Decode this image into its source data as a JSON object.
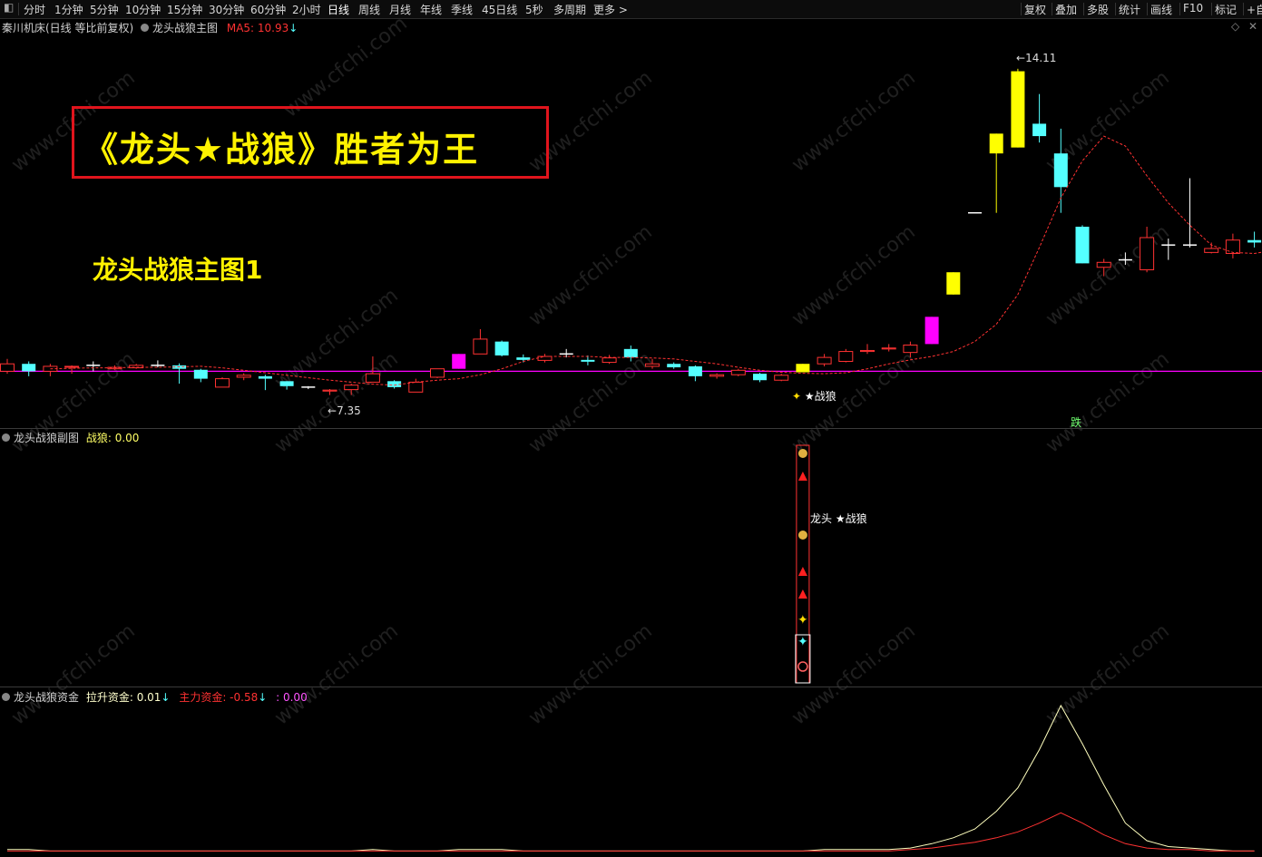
{
  "toolbar": {
    "left_items": [
      "分时",
      "1分钟",
      "5分钟",
      "10分钟",
      "15分钟",
      "30分钟",
      "60分钟",
      "2小时",
      "日线",
      "周线",
      "月线",
      "年线",
      "季线",
      "45日线",
      "5秒",
      "多周期",
      "更多 >"
    ],
    "right_items": [
      "复权",
      "叠加",
      "多股",
      "统计",
      "画线",
      "F10",
      "标记",
      "+自"
    ],
    "active": "日线"
  },
  "main_pane": {
    "stock": "秦川机床(日线 等比前复权)",
    "indicator": "龙头战狼主图",
    "ma_label": "MA5: 10.93",
    "ma_arrow": "↓",
    "high_label": "14.11",
    "low_label": "7.35",
    "signal_label": "★战狼",
    "die_label": "跌",
    "banner": "《龙头★战狼》胜者为王",
    "subtitle": "龙头战狼主图1"
  },
  "sub_pane": {
    "indicator": "龙头战狼副图",
    "value_label": "战狼: 0.00",
    "signal_text": "龙头 ★战狼"
  },
  "fund_pane": {
    "indicator": "龙头战狼资金",
    "lift_label": "拉升资金: 0.01",
    "lift_arrow": "↓",
    "main_label": "主力资金: -0.58",
    "main_arrow": "↓",
    "other_label": ": 0.00"
  },
  "watermark": "www.cfchi.com",
  "colors": {
    "up": "#ff3232",
    "down": "#54ffff",
    "yellow": "#ffff00",
    "magenta": "#ff00ff",
    "ma": "#ff3232",
    "baseline": "#ff00ff",
    "lift_line": "#ffffbe",
    "main_line": "#ff3232"
  },
  "chart_data": {
    "type": "candlestick",
    "price_ylim": [
      7.0,
      14.4
    ],
    "baseline": 8.0,
    "candles": [
      {
        "o": 8.0,
        "h": 8.25,
        "l": 7.95,
        "c": 8.15,
        "k": "up"
      },
      {
        "o": 8.15,
        "h": 8.2,
        "l": 7.9,
        "c": 8.0,
        "k": "down"
      },
      {
        "o": 8.0,
        "h": 8.15,
        "l": 7.9,
        "c": 8.1,
        "k": "up"
      },
      {
        "o": 8.1,
        "h": 8.12,
        "l": 7.95,
        "c": 8.1,
        "k": "up"
      },
      {
        "o": 8.1,
        "h": 8.2,
        "l": 8.0,
        "c": 8.12,
        "k": "flat"
      },
      {
        "o": 8.05,
        "h": 8.12,
        "l": 8.03,
        "c": 8.08,
        "k": "up"
      },
      {
        "o": 8.07,
        "h": 8.15,
        "l": 8.05,
        "c": 8.12,
        "k": "up"
      },
      {
        "o": 8.12,
        "h": 8.22,
        "l": 8.08,
        "c": 8.12,
        "k": "flat"
      },
      {
        "o": 8.12,
        "h": 8.16,
        "l": 7.75,
        "c": 8.05,
        "k": "down"
      },
      {
        "o": 8.03,
        "h": 8.05,
        "l": 7.78,
        "c": 7.85,
        "k": "down"
      },
      {
        "o": 7.68,
        "h": 7.88,
        "l": 7.68,
        "c": 7.85,
        "k": "up"
      },
      {
        "o": 7.88,
        "h": 7.96,
        "l": 7.82,
        "c": 7.92,
        "k": "up"
      },
      {
        "o": 7.9,
        "h": 7.93,
        "l": 7.62,
        "c": 7.85,
        "k": "down"
      },
      {
        "o": 7.8,
        "h": 7.8,
        "l": 7.63,
        "c": 7.7,
        "k": "down"
      },
      {
        "o": 7.68,
        "h": 7.7,
        "l": 7.64,
        "c": 7.68,
        "k": "flat"
      },
      {
        "o": 7.6,
        "h": 7.64,
        "l": 7.52,
        "c": 7.62,
        "k": "up"
      },
      {
        "o": 7.63,
        "h": 7.75,
        "l": 7.52,
        "c": 7.72,
        "k": "up"
      },
      {
        "o": 7.78,
        "h": 8.3,
        "l": 7.78,
        "c": 7.95,
        "k": "up"
      },
      {
        "o": 7.8,
        "h": 7.82,
        "l": 7.65,
        "c": 7.68,
        "k": "down"
      },
      {
        "o": 7.58,
        "h": 7.85,
        "l": 7.58,
        "c": 7.78,
        "k": "up"
      },
      {
        "o": 7.88,
        "h": 8.05,
        "l": 7.86,
        "c": 8.05,
        "k": "up"
      },
      {
        "o": 8.05,
        "h": 8.35,
        "l": 8.05,
        "c": 8.35,
        "k": "magenta"
      },
      {
        "o": 8.35,
        "h": 8.85,
        "l": 8.35,
        "c": 8.65,
        "k": "up"
      },
      {
        "o": 8.6,
        "h": 8.62,
        "l": 8.3,
        "c": 8.32,
        "k": "down"
      },
      {
        "o": 8.28,
        "h": 8.34,
        "l": 8.18,
        "c": 8.23,
        "k": "down"
      },
      {
        "o": 8.22,
        "h": 8.35,
        "l": 8.18,
        "c": 8.3,
        "k": "up"
      },
      {
        "o": 8.33,
        "h": 8.45,
        "l": 8.28,
        "c": 8.35,
        "k": "flat"
      },
      {
        "o": 8.23,
        "h": 8.32,
        "l": 8.12,
        "c": 8.2,
        "k": "down"
      },
      {
        "o": 8.18,
        "h": 8.33,
        "l": 8.15,
        "c": 8.27,
        "k": "up"
      },
      {
        "o": 8.45,
        "h": 8.52,
        "l": 8.2,
        "c": 8.28,
        "k": "down"
      },
      {
        "o": 8.1,
        "h": 8.25,
        "l": 8.05,
        "c": 8.15,
        "k": "up"
      },
      {
        "o": 8.15,
        "h": 8.18,
        "l": 8.05,
        "c": 8.08,
        "k": "down"
      },
      {
        "o": 8.1,
        "h": 8.12,
        "l": 7.8,
        "c": 7.9,
        "k": "down"
      },
      {
        "o": 7.9,
        "h": 7.96,
        "l": 7.85,
        "c": 7.93,
        "k": "up"
      },
      {
        "o": 7.93,
        "h": 8.05,
        "l": 7.9,
        "c": 8.02,
        "k": "up"
      },
      {
        "o": 7.95,
        "h": 7.97,
        "l": 7.78,
        "c": 7.82,
        "k": "down"
      },
      {
        "o": 7.82,
        "h": 7.95,
        "l": 7.8,
        "c": 7.92,
        "k": "up"
      },
      {
        "o": 7.98,
        "h": 8.15,
        "l": 7.98,
        "c": 8.15,
        "k": "yellow"
      },
      {
        "o": 8.15,
        "h": 8.35,
        "l": 8.1,
        "c": 8.28,
        "k": "up"
      },
      {
        "o": 8.2,
        "h": 8.45,
        "l": 8.18,
        "c": 8.4,
        "k": "up"
      },
      {
        "o": 8.4,
        "h": 8.55,
        "l": 8.35,
        "c": 8.42,
        "k": "up"
      },
      {
        "o": 8.45,
        "h": 8.55,
        "l": 8.4,
        "c": 8.47,
        "k": "up"
      },
      {
        "o": 8.38,
        "h": 8.6,
        "l": 8.28,
        "c": 8.53,
        "k": "up"
      },
      {
        "o": 8.55,
        "h": 9.1,
        "l": 8.55,
        "c": 9.1,
        "k": "magenta"
      },
      {
        "o": 9.55,
        "h": 10.0,
        "l": 9.55,
        "c": 10.0,
        "k": "yellow"
      },
      {
        "o": 11.2,
        "h": 11.2,
        "l": 11.2,
        "c": 11.2,
        "k": "flat"
      },
      {
        "o": 12.4,
        "h": 12.8,
        "l": 11.2,
        "c": 12.8,
        "k": "yellow"
      },
      {
        "o": 12.52,
        "h": 14.11,
        "l": 12.52,
        "c": 14.06,
        "k": "yellow"
      },
      {
        "o": 13.0,
        "h": 13.6,
        "l": 12.62,
        "c": 12.75,
        "k": "down"
      },
      {
        "o": 12.4,
        "h": 12.9,
        "l": 11.2,
        "c": 11.72,
        "k": "down"
      },
      {
        "o": 10.92,
        "h": 10.95,
        "l": 10.18,
        "c": 10.18,
        "k": "down"
      },
      {
        "o": 10.1,
        "h": 10.27,
        "l": 9.92,
        "c": 10.2,
        "k": "up"
      },
      {
        "o": 10.25,
        "h": 10.4,
        "l": 10.15,
        "c": 10.25,
        "k": "flat"
      },
      {
        "o": 10.05,
        "h": 10.92,
        "l": 10.0,
        "c": 10.7,
        "k": "up"
      },
      {
        "o": 10.55,
        "h": 10.68,
        "l": 10.25,
        "c": 10.55,
        "k": "flat"
      },
      {
        "o": 10.55,
        "h": 11.9,
        "l": 10.5,
        "c": 10.55,
        "k": "flat"
      },
      {
        "o": 10.4,
        "h": 10.6,
        "l": 10.38,
        "c": 10.48,
        "k": "up"
      },
      {
        "o": 10.38,
        "h": 10.78,
        "l": 10.28,
        "c": 10.65,
        "k": "up"
      },
      {
        "o": 10.65,
        "h": 10.82,
        "l": 10.5,
        "c": 10.6,
        "k": "down"
      }
    ],
    "ma5": [
      8.05,
      8.06,
      8.07,
      8.07,
      8.08,
      8.08,
      8.09,
      8.1,
      8.07,
      8.02,
      7.97,
      7.92,
      7.87,
      7.82,
      7.78,
      7.74,
      7.72,
      7.78,
      7.82,
      7.85,
      7.93,
      8.05,
      8.2,
      8.3,
      8.3,
      8.3,
      8.28,
      8.28,
      8.27,
      8.25,
      8.2,
      8.15,
      8.08,
      8.02,
      7.98,
      7.96,
      7.95,
      7.97,
      8.05,
      8.15,
      8.23,
      8.3,
      8.4,
      8.6,
      8.95,
      9.55,
      10.5,
      11.5,
      12.25,
      12.75,
      12.55,
      11.95,
      11.4,
      10.95,
      10.55,
      10.4,
      10.38,
      10.45,
      10.5
    ],
    "fund_lift": [
      0.02,
      0.02,
      0.01,
      0.01,
      0.01,
      0.01,
      0.01,
      0.01,
      0.01,
      0.01,
      0.01,
      0.01,
      0.01,
      0.01,
      0.01,
      0.01,
      0.01,
      0.02,
      0.01,
      0.01,
      0.01,
      0.02,
      0.02,
      0.02,
      0.01,
      0.01,
      0.01,
      0.01,
      0.01,
      0.01,
      0.01,
      0.01,
      0.01,
      0.01,
      0.01,
      0.01,
      0.01,
      0.01,
      0.02,
      0.02,
      0.02,
      0.02,
      0.03,
      0.06,
      0.1,
      0.16,
      0.28,
      0.44,
      0.7,
      1.0,
      0.74,
      0.46,
      0.2,
      0.08,
      0.04,
      0.03,
      0.02,
      0.01,
      0.01
    ],
    "fund_main": [
      0.01,
      0.01,
      0.01,
      0.01,
      0.01,
      0.01,
      0.01,
      0.01,
      0.01,
      0.01,
      0.01,
      0.01,
      0.01,
      0.01,
      0.01,
      0.01,
      0.01,
      0.01,
      0.01,
      0.01,
      0.01,
      0.01,
      0.01,
      0.01,
      0.01,
      0.01,
      0.01,
      0.01,
      0.01,
      0.01,
      0.01,
      0.01,
      0.01,
      0.01,
      0.01,
      0.01,
      0.01,
      0.01,
      0.01,
      0.01,
      0.01,
      0.01,
      0.02,
      0.03,
      0.05,
      0.07,
      0.1,
      0.14,
      0.2,
      0.27,
      0.2,
      0.12,
      0.06,
      0.03,
      0.02,
      0.02,
      0.01,
      0.01,
      0.01
    ]
  }
}
